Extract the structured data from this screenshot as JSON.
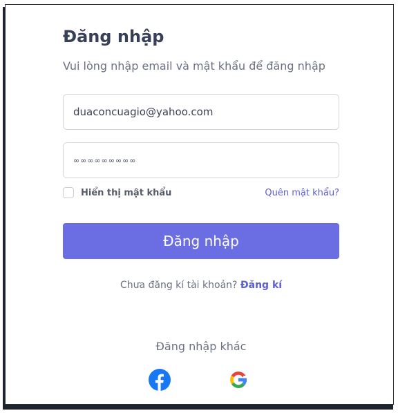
{
  "login": {
    "title": "Đăng nhập",
    "subtitle": "Vui lòng nhập email và mật khẩu để đăng nhập",
    "email_value": "duaconcuagio@yahoo.com",
    "password_display": "∞∞∞∞∞∞∞∞∞",
    "show_password_label": "Hiển thị mật khẩu",
    "forgot_label": "Quên mật khẩu?",
    "submit_label": "Đăng nhập",
    "no_account_text": "Chưa đăng kí tài khoản?",
    "signup_label": "Đăng kí",
    "other_methods": "Đăng nhập khác"
  },
  "social": {
    "facebook_icon": "facebook-icon",
    "google_icon": "google-icon"
  },
  "colors": {
    "accent": "#6b6ee3",
    "link": "#5d5ed6",
    "title": "#384057",
    "muted": "#6b7183"
  }
}
